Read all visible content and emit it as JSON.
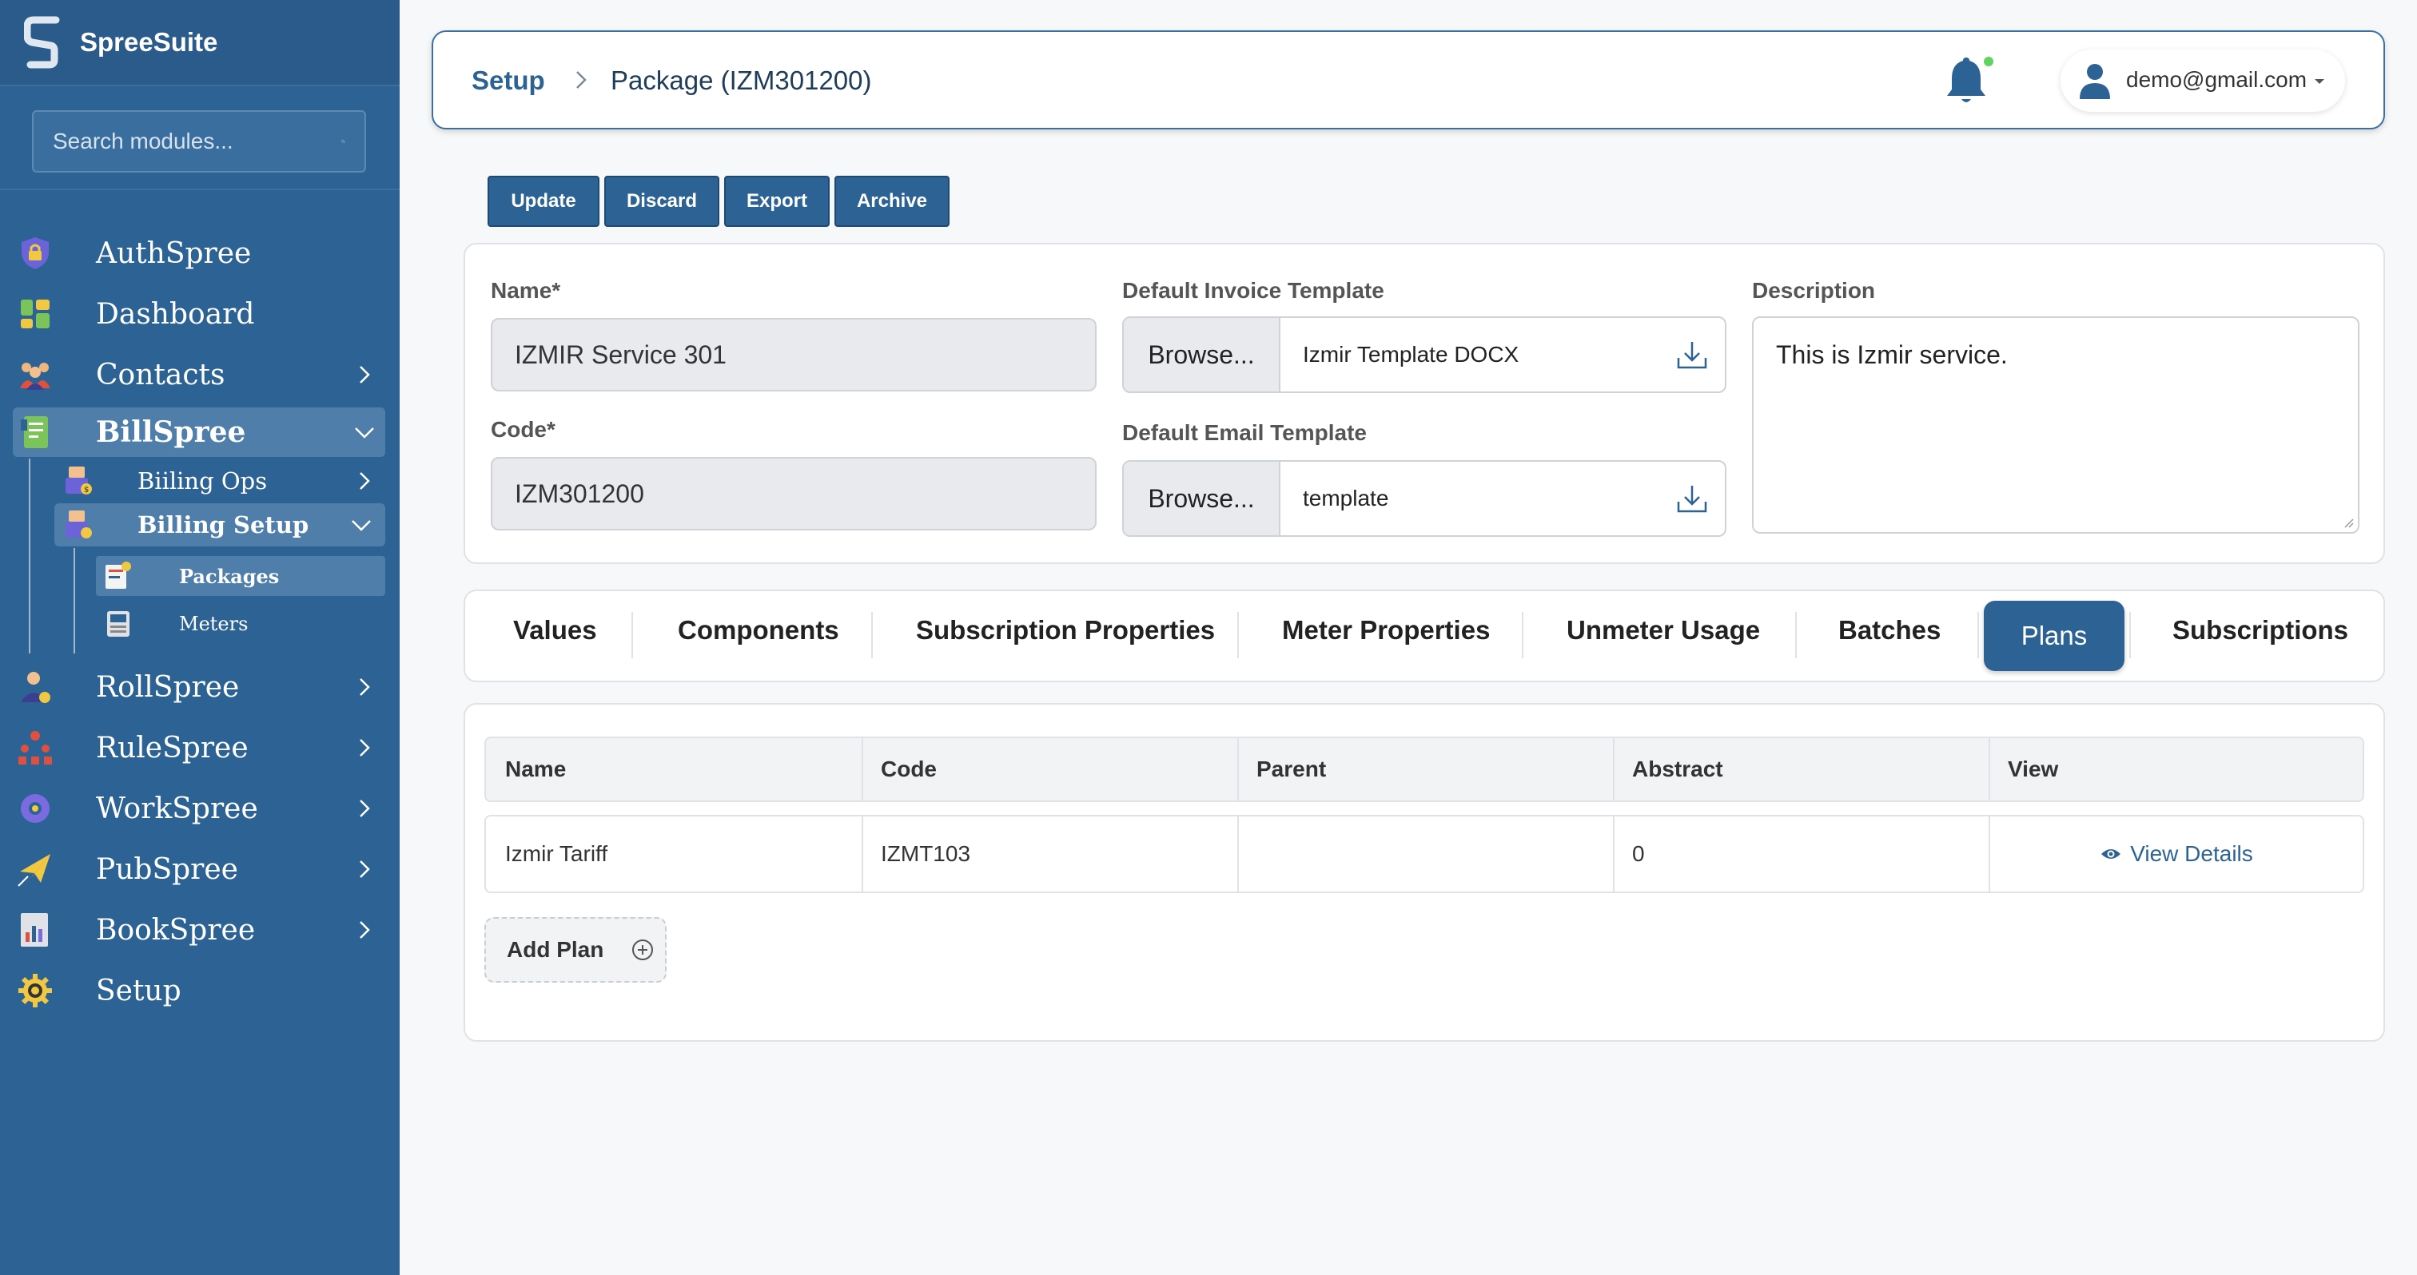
{
  "app": {
    "brand": "SpreeSuite"
  },
  "search": {
    "placeholder": "Search modules..."
  },
  "sidebar": {
    "items": [
      {
        "label": "AuthSpree",
        "icon": "shield-lock-icon"
      },
      {
        "label": "Dashboard",
        "icon": "dashboard-tiles-icon"
      },
      {
        "label": "Contacts",
        "icon": "people-icon"
      },
      {
        "label": "BillSpree",
        "icon": "bill-sheet-icon"
      },
      {
        "label": "RollSpree",
        "icon": "payroll-person-icon"
      },
      {
        "label": "RuleSpree",
        "icon": "org-chart-icon"
      },
      {
        "label": "WorkSpree",
        "icon": "team-gear-icon"
      },
      {
        "label": "PubSpree",
        "icon": "paper-plane-icon"
      },
      {
        "label": "BookSpree",
        "icon": "ledger-chart-icon"
      },
      {
        "label": "Setup",
        "icon": "gear-icon"
      }
    ],
    "billspree_children": [
      {
        "label": "Biiling Ops"
      },
      {
        "label": "Billing Setup"
      }
    ],
    "billing_setup_children": [
      {
        "label": "Packages"
      },
      {
        "label": "Meters"
      }
    ]
  },
  "header": {
    "breadcrumb_root": "Setup",
    "breadcrumb_page": "Package (IZM301200)",
    "user_email": "demo@gmail.com",
    "notification_dot_color": "#5fd35f"
  },
  "toolbar": {
    "update": "Update",
    "discard": "Discard",
    "export": "Export",
    "archive": "Archive"
  },
  "form": {
    "name_label": "Name*",
    "name_value": "IZMIR Service 301",
    "code_label": "Code*",
    "code_value": "IZM301200",
    "invoice_label": "Default Invoice Template",
    "invoice_browse": "Browse...",
    "invoice_file": "Izmir Template DOCX",
    "email_label": "Default Email Template",
    "email_browse": "Browse...",
    "email_file": "template",
    "description_label": "Description",
    "description_value": "This is Izmir service."
  },
  "tabs": [
    {
      "label": "Values"
    },
    {
      "label": "Components"
    },
    {
      "label": "Subscription Properties"
    },
    {
      "label": "Meter Properties"
    },
    {
      "label": "Unmeter Usage"
    },
    {
      "label": "Batches"
    },
    {
      "label": "Plans",
      "active": true
    },
    {
      "label": "Subscriptions"
    }
  ],
  "plans_table": {
    "columns": [
      "Name",
      "Code",
      "Parent",
      "Abstract",
      "View"
    ],
    "rows": [
      {
        "name": "Izmir Tariff",
        "code": "IZMT103",
        "parent": "",
        "abstract": "0",
        "view": "View Details"
      }
    ],
    "add_label": "Add Plan"
  },
  "colors": {
    "primary": "#2d6394",
    "sidebar": "#2d6394",
    "active_nav": "#4e7ea9"
  }
}
